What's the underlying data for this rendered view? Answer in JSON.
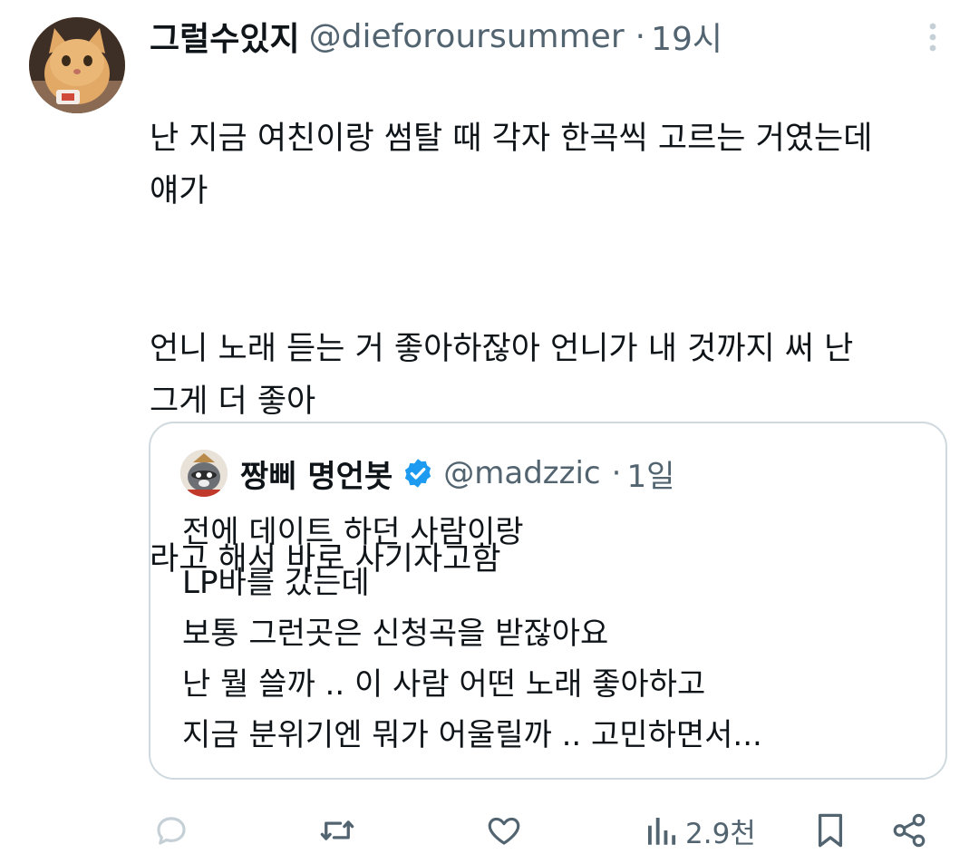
{
  "tweet": {
    "author_name": "그럴수있지",
    "handle": "@dieforoursummer",
    "separator": "·",
    "time": "19시",
    "paragraphs": [
      "난 지금 여친이랑 썸탈 때 각자 한곡씩 고르는 거였는데\n얘가",
      "언니 노래 듣는 거 좋아하잖아 언니가 내 것까지 써 난\n그게 더 좋아",
      "라고 해서 바로 사기자고함"
    ]
  },
  "quote": {
    "author_name": "짱삐 명언봇",
    "handle": "@madzzic",
    "separator": "·",
    "time": "1일",
    "lines": [
      "전에 데이트 하던 사람이랑",
      "LP바를 갔는데",
      "보통 그런곳은 신청곡을 받잖아요",
      "난 뭘 쓸까 .. 이 사람 어떤 노래 좋아하고",
      "지금 분위기엔 뭐가 어울릴까 .. 고민하면서..."
    ]
  },
  "actions": {
    "views": "2.9천",
    "icons": [
      "reply-icon",
      "retweet-icon",
      "like-icon",
      "views-icon",
      "bookmark-icon",
      "share-icon"
    ]
  },
  "colors": {
    "text": "#0f1419",
    "secondary": "#536471",
    "verified": "#1d9bf0",
    "border": "#cfd9de",
    "reply_icon": "#c4cfd6"
  }
}
